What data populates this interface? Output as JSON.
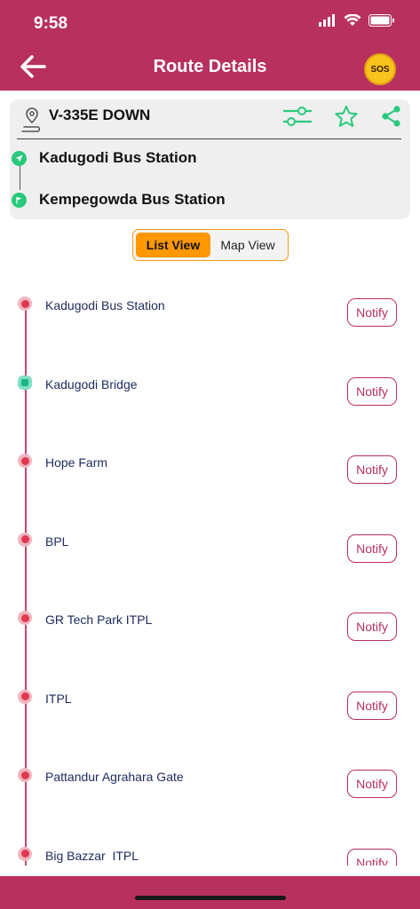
{
  "status_bar": {
    "time": "9:58"
  },
  "header": {
    "title": "Route Details",
    "sos_label": "SOS"
  },
  "route": {
    "name": "V-335E DOWN",
    "origin": "Kadugodi Bus Station",
    "destination": "Kempegowda Bus Station"
  },
  "view_toggle": {
    "list_label": "List View",
    "map_label": "Map View",
    "selected": "List View"
  },
  "stops": [
    {
      "name": "Kadugodi Bus Station",
      "marker": "stop",
      "notify_label": "Notify"
    },
    {
      "name": "Kadugodi Bridge",
      "marker": "bus",
      "notify_label": "Notify"
    },
    {
      "name": "Hope Farm",
      "marker": "stop",
      "notify_label": "Notify"
    },
    {
      "name": "BPL",
      "marker": "stop",
      "notify_label": "Notify"
    },
    {
      "name": "GR Tech Park ITPL",
      "marker": "stop",
      "notify_label": "Notify"
    },
    {
      "name": "ITPL",
      "marker": "stop",
      "notify_label": "Notify"
    },
    {
      "name": "Pattandur Agrahara Gate",
      "marker": "stop",
      "notify_label": "Notify"
    },
    {
      "name": "Big Bazzar  ITPL",
      "marker": "stop",
      "notify_label": "Notify"
    }
  ],
  "colors": {
    "primary": "#b8305e",
    "accent": "#ff9800",
    "success": "#29c97d",
    "stop_dot": "#e0394f"
  }
}
